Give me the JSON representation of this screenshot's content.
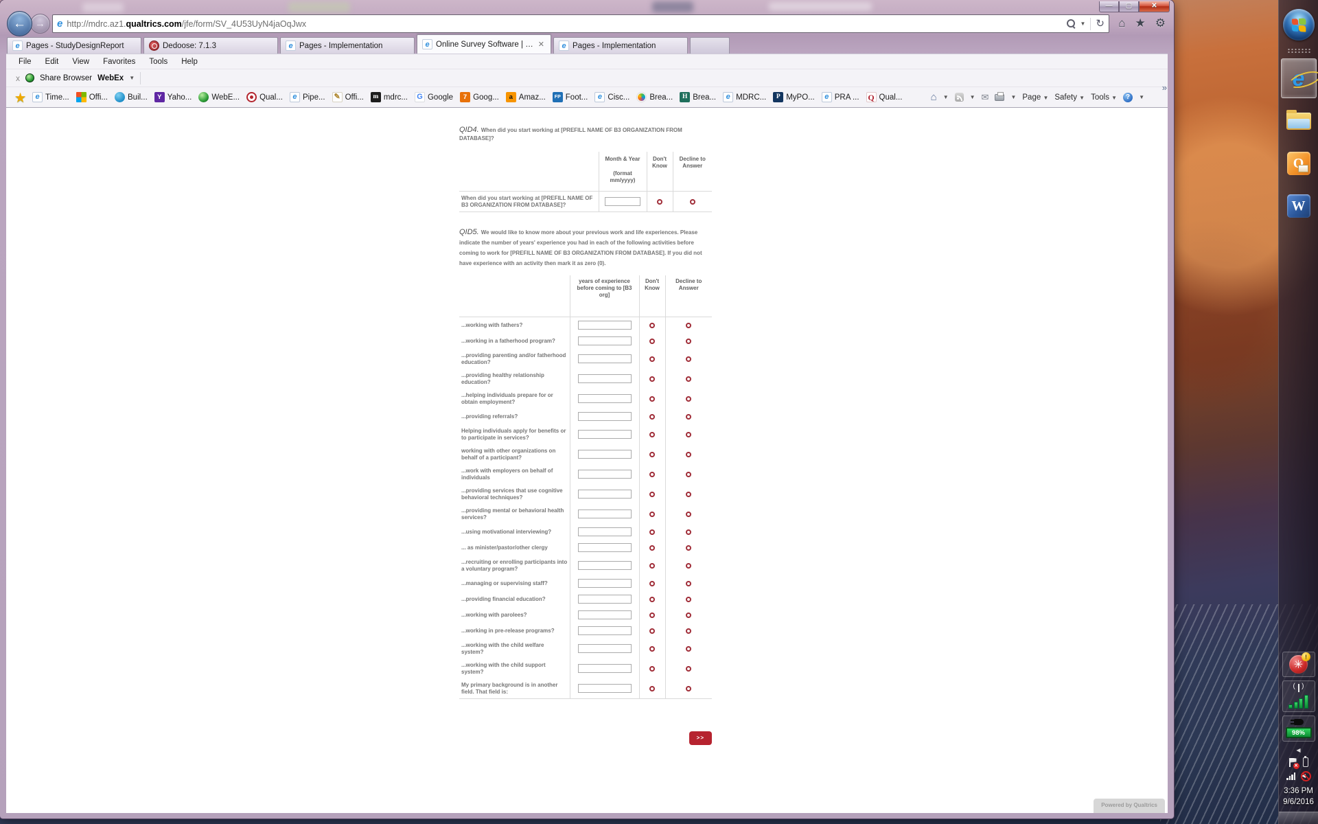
{
  "browser": {
    "address": {
      "scheme": "http://",
      "subdomain": "mdrc.az1.",
      "domain": "qualtrics.com",
      "path": "/jfe/form/SV_4U53UyN4jaOqJwx"
    },
    "tabs": [
      {
        "label": "Pages - StudyDesignReport",
        "icon": "ie",
        "active": false
      },
      {
        "label": "Dedoose: 7.1.3",
        "icon": "dedoose",
        "active": false
      },
      {
        "label": "Pages - Implementation",
        "icon": "ie",
        "active": false
      },
      {
        "label": "Online Survey Software | Qu...",
        "icon": "ie",
        "active": true,
        "closable": true
      },
      {
        "label": "Pages - Implementation",
        "icon": "ie",
        "active": false
      }
    ],
    "menu": [
      "File",
      "Edit",
      "View",
      "Favorites",
      "Tools",
      "Help"
    ],
    "webex": {
      "close": "x",
      "share_label": "Share Browser",
      "brand": "WebEx"
    },
    "favorites": [
      {
        "icon": "ie-page",
        "glyph": "e",
        "label": "Time..."
      },
      {
        "icon": "office",
        "glyph": "",
        "label": "Offi..."
      },
      {
        "icon": "builder-blue",
        "glyph": "",
        "label": "Buil..."
      },
      {
        "icon": "yahoo",
        "glyph": "Y",
        "label": "Yaho..."
      },
      {
        "icon": "webex-sphere",
        "glyph": "",
        "label": "WebE..."
      },
      {
        "icon": "qualtrics-target",
        "glyph": "",
        "label": "Qual..."
      },
      {
        "icon": "ie-page",
        "glyph": "e",
        "label": "Pipe..."
      },
      {
        "icon": "pencil",
        "glyph": "✎",
        "label": "Offi..."
      },
      {
        "icon": "mdrc",
        "glyph": "m",
        "label": "mdrc..."
      },
      {
        "icon": "google",
        "glyph": "G",
        "label": "Google"
      },
      {
        "icon": "calendar7",
        "glyph": "7",
        "label": "Goog..."
      },
      {
        "icon": "amazon",
        "glyph": "a",
        "label": "Amaz..."
      },
      {
        "icon": "fp",
        "glyph": "FP",
        "label": "Foot..."
      },
      {
        "icon": "ie-page",
        "glyph": "e",
        "label": "Cisc..."
      },
      {
        "icon": "nbc",
        "glyph": "",
        "label": "Brea..."
      },
      {
        "icon": "h-green",
        "glyph": "H",
        "label": "Brea..."
      },
      {
        "icon": "ie-page",
        "glyph": "e",
        "label": "MDRC..."
      },
      {
        "icon": "p-navy",
        "glyph": "P",
        "label": "MyPO..."
      },
      {
        "icon": "ie-page",
        "glyph": "e",
        "label": "PRA ..."
      },
      {
        "icon": "q-red",
        "glyph": "Q",
        "label": "Qual..."
      }
    ],
    "commands": {
      "page": "Page",
      "safety": "Safety",
      "tools": "Tools"
    },
    "overflow_chevron": "»"
  },
  "survey": {
    "qid4": {
      "label": "QID4.",
      "text": "When did you start working at [PREFILL NAME OF B3 ORGANIZATION FROM DATABASE]?",
      "col1_line1": "Month & Year",
      "col1_line2": "(format mm/yyyy)",
      "dont_know": "Don't Know",
      "decline": "Decline to Answer",
      "row_label": "When did you start working at [PREFILL NAME OF B3 ORGANIZATION FROM DATABASE]?"
    },
    "qid5": {
      "label": "QID5.",
      "text": "We would like to know more about your previous work and life experiences. Please indicate the number of years' experience you had in each of the following activities before coming to work for [PREFILL NAME OF B3 ORGANIZATION FROM DATABASE]. If you did not have experience with an activity then mark it as zero (0).",
      "col1": "years of experience before coming to [B3 org]",
      "dont_know": "Don't Know",
      "decline": "Decline to Answer",
      "rows": [
        "...working with fathers?",
        "...working in a fatherhood program?",
        "...providing parenting and/or fatherhood education?",
        "...providing healthy relationship education?",
        "...helping individuals prepare for or obtain employment?",
        "...providing referrals?",
        "Helping individuals apply for benefits or to participate in services?",
        "working with other organizations on behalf of a participant?",
        "...work with employers on behalf of individuals",
        "...providing services that use cognitive behavioral techniques?",
        "...providing mental or behavioral health services?",
        "...using motivational interviewing?",
        "... as minister/pastor/other clergy",
        "...recruiting or enrolling participants into a voluntary program?",
        "...managing or supervising staff?",
        "...providing financial education?",
        "...working with parolees?",
        "...working in pre-release programs?",
        "...working with the child welfare system?",
        "...working with the child support system?",
        "My primary background is in another field. That field is:"
      ]
    },
    "next_label": ">>",
    "powered_by": "Powered by Qualtrics"
  },
  "tray": {
    "battery_percent": "98%",
    "time": "3:36 PM",
    "date": "9/6/2016"
  },
  "colors": {
    "accent_red": "#b6232f",
    "radio_ring": "#a02d38",
    "taskbar_battery_green": "#0d8c33"
  }
}
